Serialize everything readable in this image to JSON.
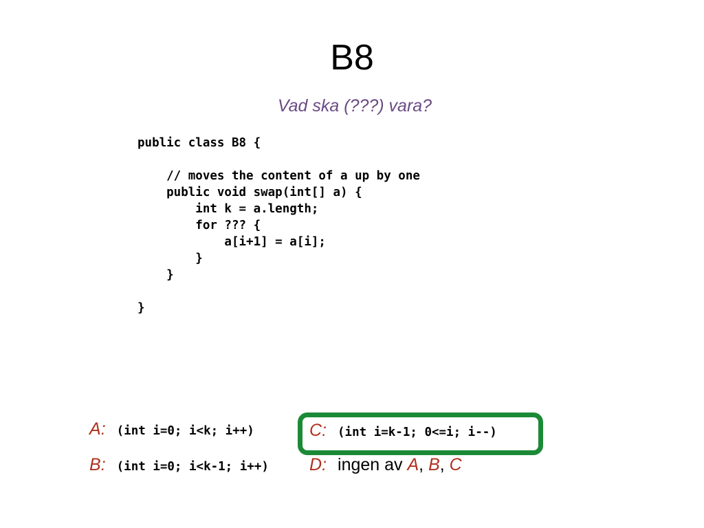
{
  "slide": {
    "title": "B8",
    "subtitle": "Vad ska (???) vara?",
    "code_lines": [
      "public class B8 {",
      "",
      "    // moves the content of a up by one",
      "    public void swap(int[] a) {",
      "        int k = a.length;",
      "        for ??? {",
      "            a[i+1] = a[i];",
      "        }",
      "    }",
      "",
      "}"
    ],
    "options": {
      "a": {
        "letter": "A",
        "colon": ":",
        "text": "(int i=0; i<k; i++)"
      },
      "b": {
        "letter": "B",
        "colon": ":",
        "text": "(int i=0; i<k-1; i++)"
      },
      "c": {
        "letter": "C",
        "colon": ":",
        "text": "(int i=k-1; 0<=i; i--)",
        "highlighted": true
      },
      "d": {
        "letter": "D",
        "colon": ":",
        "text": "ingen av ",
        "refs": [
          "A",
          "B",
          "C"
        ],
        "sep1": ", ",
        "sep2": ", "
      }
    },
    "colors": {
      "subtitle": "#6a4a84",
      "option_letter": "#b0301e",
      "highlight_border": "#1b8a36"
    }
  }
}
